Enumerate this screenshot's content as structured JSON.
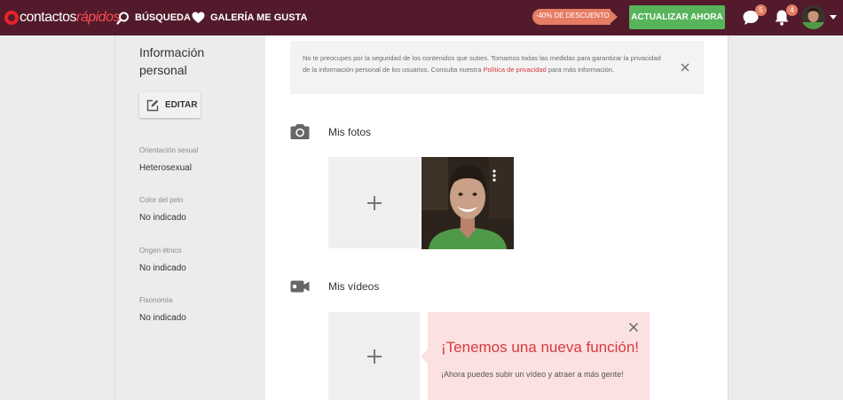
{
  "header": {
    "logo_part1": "contactos",
    "logo_part2": "rápidos",
    "nav": {
      "search_label": "BÚSQUEDA",
      "gallery_label": "GALERÍA ME GUSTA"
    },
    "promo_label": "-40% DE DESCUENTO",
    "upgrade_label": "ACTUALIZAR AHORA",
    "messages_count": "5",
    "notifications_count": "4"
  },
  "sidebar": {
    "title": "Información personal",
    "edit_label": "EDITAR",
    "attributes": [
      {
        "label": "Orientación sexual",
        "value": "Heterosexual"
      },
      {
        "label": "Color del pelo",
        "value": "No indicado"
      },
      {
        "label": "Origen étnico",
        "value": "No indicado"
      },
      {
        "label": "Fisonomía",
        "value": "No indicado"
      }
    ]
  },
  "notice": {
    "text_before": "No te preocupes por la seguridad de los contenidos que subes. Tomamos todas las medidas para garantizar la privacidad de la información personal de los usuarios. Consulta nuestra ",
    "link": "Política de privacidad",
    "text_after": " para más información."
  },
  "photos": {
    "title": "Mis fotos"
  },
  "videos": {
    "title": "Mis vídeos"
  },
  "tooltip": {
    "title": "¡Tenemos una nueva función!",
    "text": "¡Ahora puedes subir un vídeo y atraer a más gente!"
  },
  "colors": {
    "topbar": "#521a2a",
    "upgrade": "#57b45b",
    "promo": "#e57c63",
    "accent_red": "#d8393f",
    "tooltip_bg": "#fbe1e1"
  },
  "icons": [
    "search-icon",
    "heart-icon",
    "chat-icon",
    "bell-icon",
    "edit-icon",
    "camera-icon",
    "video-camera-icon",
    "plus-icon",
    "close-icon",
    "more-vertical-icon"
  ]
}
